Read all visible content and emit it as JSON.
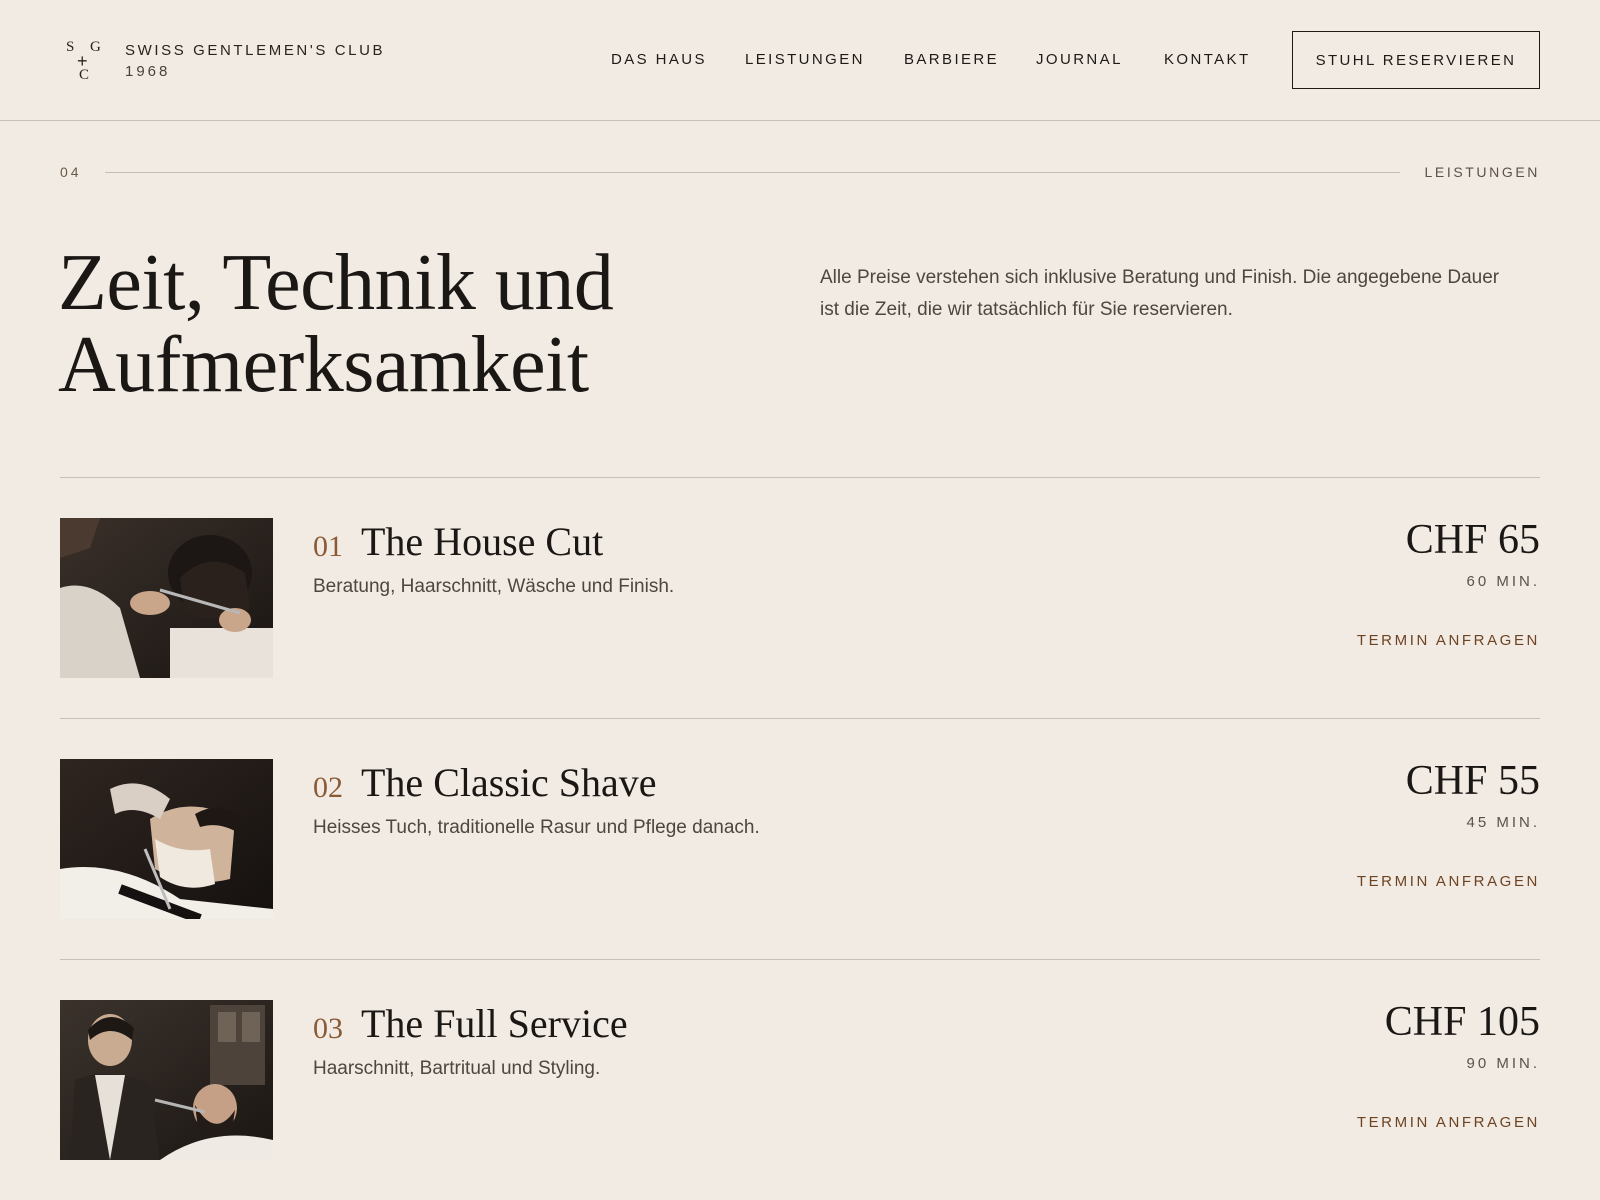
{
  "brand": {
    "monogram": {
      "s": "S",
      "g": "G",
      "plus": "+",
      "c": "C"
    },
    "name": "SWISS GENTLEMEN'S CLUB",
    "year": "1968"
  },
  "nav": {
    "items": [
      {
        "label": "DAS HAUS"
      },
      {
        "label": "LEISTUNGEN"
      },
      {
        "label": "BARBIERE"
      },
      {
        "label": "JOURNAL"
      },
      {
        "label": "KONTAKT"
      }
    ],
    "cta_label": "STUHL RESERVIEREN"
  },
  "section": {
    "number": "04",
    "label": "LEISTUNGEN",
    "headline_line1": "Zeit, Technik und",
    "headline_line2": "Aufmerksamkeit",
    "intro": "Alle Preise verstehen sich inklusive Beratung und Finish. Die angegebene Dauer ist die Zeit, die wir tatsächlich für Sie reservieren."
  },
  "services": [
    {
      "number": "01",
      "title": "The House Cut",
      "description": "Beratung, Haarschnitt, Wäsche und Finish.",
      "price": "CHF 65",
      "duration": "60 MIN.",
      "link_label": "TERMIN ANFRAGEN",
      "image_icon": "haircut-photo"
    },
    {
      "number": "02",
      "title": "The Classic Shave",
      "description": "Heisses Tuch, traditionelle Rasur und Pflege danach.",
      "price": "CHF 55",
      "duration": "45 MIN.",
      "link_label": "TERMIN ANFRAGEN",
      "image_icon": "shave-photo"
    },
    {
      "number": "03",
      "title": "The Full Service",
      "description": "Haarschnitt, Bartritual und Styling.",
      "price": "CHF 105",
      "duration": "90 MIN.",
      "link_label": "TERMIN ANFRAGEN",
      "image_icon": "full-service-photo"
    }
  ],
  "colors": {
    "background": "#f1ebe4",
    "text": "#1f1a16",
    "accent": "#8a5a34",
    "link": "#6e4321",
    "divider": "#c9c1b8"
  }
}
